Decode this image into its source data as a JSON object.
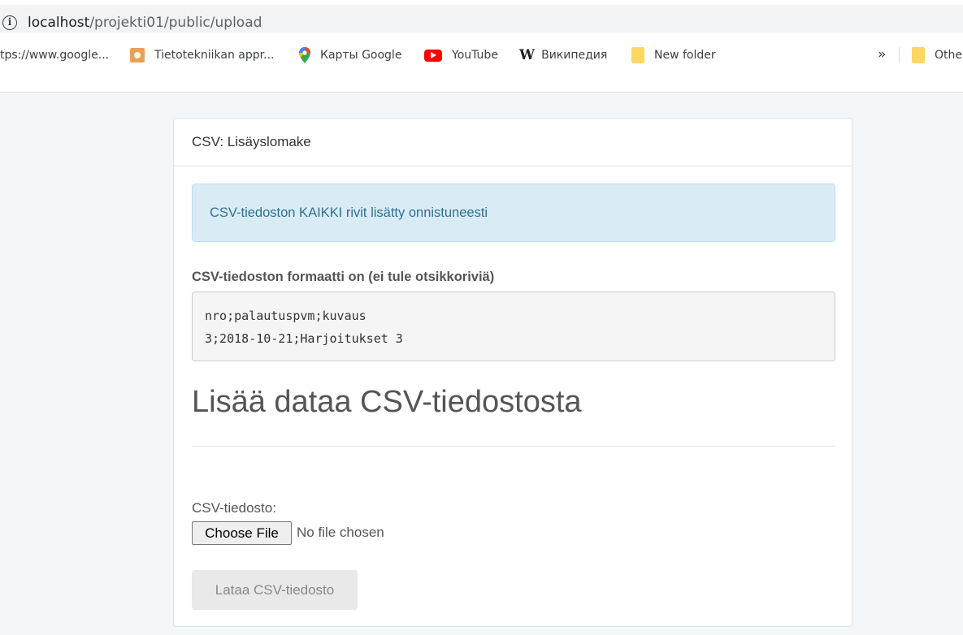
{
  "browser": {
    "url_host": "localhost",
    "url_path": "/projekti01/public/upload",
    "bookmarks": [
      {
        "label": "tps://www.google...",
        "icon": "none"
      },
      {
        "label": "Tietotekniikan appr...",
        "icon": "tietotekniikka-icon"
      },
      {
        "label": "Карты Google",
        "icon": "google-maps-icon"
      },
      {
        "label": "YouTube",
        "icon": "youtube-icon"
      },
      {
        "label": "Википедия",
        "icon": "wikipedia-icon"
      },
      {
        "label": "New folder",
        "icon": "folder-icon"
      }
    ],
    "overflow_label": "»",
    "other_label": "Othe"
  },
  "page": {
    "card_title": "CSV: Lisäyslomake",
    "alert": "CSV-tiedoston KAIKKI rivit lisätty onnistuneesti",
    "format_title": "CSV-tiedoston formaatti on (ei tule otsikkoriviä)",
    "code_lines": [
      "nro;palautuspvm;kuvaus",
      "3;2018-10-21;Harjoitukset 3"
    ],
    "heading": "Lisää dataa CSV-tiedostosta",
    "file_label": "CSV-tiedosto:",
    "file_button": "Choose File",
    "file_status": "No file chosen",
    "submit_button": "Lataa CSV-tiedosto"
  },
  "colors": {
    "alert_bg": "#d9ecf5",
    "alert_text": "#31708f",
    "page_bg": "#f4f7fa"
  }
}
